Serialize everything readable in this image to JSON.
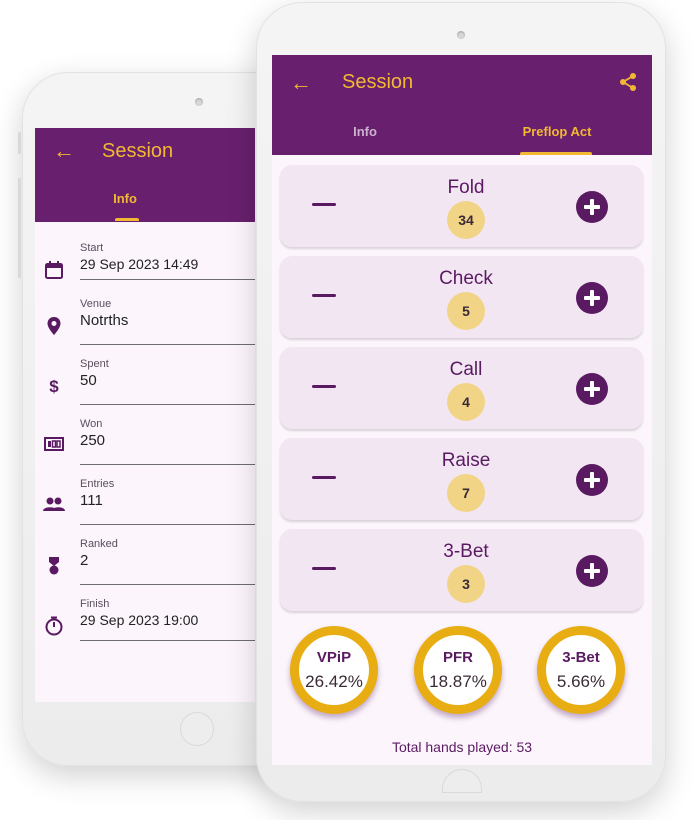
{
  "colors": {
    "primary": "#68206e",
    "accent": "#f2b833",
    "badge": "#f2d486",
    "ring": "#e7ad12",
    "background": "#fcf6fc"
  },
  "info_screen": {
    "title": "Session",
    "back_icon": "arrow-left-icon",
    "tab": "Info",
    "fields": [
      {
        "icon": "calendar-icon",
        "label": "Start",
        "value": "29 Sep 2023 14:49"
      },
      {
        "icon": "location-pin-icon",
        "label": "Venue",
        "value": "Notrths"
      },
      {
        "icon": "dollar-icon",
        "label": "Spent",
        "value": "50"
      },
      {
        "icon": "cash-icon",
        "label": "Won",
        "value": "250"
      },
      {
        "icon": "people-icon",
        "label": "Entries",
        "value": "111"
      },
      {
        "icon": "medal-icon",
        "label": "Ranked",
        "value": "2"
      },
      {
        "icon": "stopwatch-icon",
        "label": "Finish",
        "value": "29 Sep 2023 19:00"
      }
    ]
  },
  "preflop_screen": {
    "title": "Session",
    "back_icon": "arrow-left-icon",
    "share_icon": "share-icon",
    "tabs": [
      {
        "label": "Info",
        "active": false
      },
      {
        "label": "Preflop Act",
        "active": true
      }
    ],
    "actions": [
      {
        "name": "Fold",
        "count": "34"
      },
      {
        "name": "Check",
        "count": "5"
      },
      {
        "name": "Call",
        "count": "4"
      },
      {
        "name": "Raise",
        "count": "7"
      },
      {
        "name": "3-Bet",
        "count": "3"
      }
    ],
    "stats": [
      {
        "label": "VPiP",
        "value": "26.42%"
      },
      {
        "label": "PFR",
        "value": "18.87%"
      },
      {
        "label": "3-Bet",
        "value": "5.66%"
      }
    ],
    "total": "Total hands played: 53"
  }
}
